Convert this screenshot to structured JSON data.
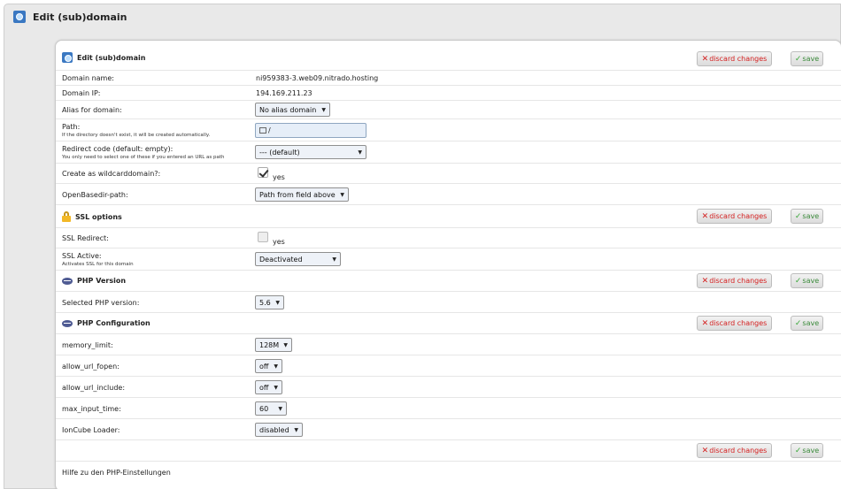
{
  "page": {
    "title": "Edit (sub)domain"
  },
  "sections": {
    "main": {
      "title": "Edit (sub)domain"
    },
    "ssl": {
      "title": "SSL options"
    },
    "php_version": {
      "title": "PHP Version"
    },
    "php_config": {
      "title": "PHP Configuration"
    }
  },
  "buttons": {
    "discard": "discard changes",
    "save": "save"
  },
  "fields": {
    "domain_name": {
      "label": "Domain name:",
      "value": "ni959383-3.web09.nitrado.hosting"
    },
    "domain_ip": {
      "label": "Domain IP:",
      "value": "194.169.211.23"
    },
    "alias": {
      "label": "Alias for domain:",
      "value": "No alias domain"
    },
    "path": {
      "label": "Path:",
      "hint": "If the directory doesn't exist, it will be created automatically.",
      "value": "/"
    },
    "redirect": {
      "label": "Redirect code (default: empty):",
      "hint": "You only need to select one of these if you entered an URL as path",
      "value": "--- (default)"
    },
    "wildcard": {
      "label": "Create as wildcarddomain?:",
      "checked": true,
      "option": "yes"
    },
    "openbasedir": {
      "label": "OpenBasedir-path:",
      "value": "Path from field above"
    },
    "ssl_redirect": {
      "label": "SSL Redirect:",
      "checked": false,
      "option": "yes"
    },
    "ssl_active": {
      "label": "SSL Active:",
      "hint": "Activates SSL for this domain",
      "value": "Deactivated"
    },
    "php_version": {
      "label": "Selected PHP version:",
      "value": "5.6"
    },
    "memory_limit": {
      "label": "memory_limit:",
      "value": "128M"
    },
    "allow_url_fopen": {
      "label": "allow_url_fopen:",
      "value": "off"
    },
    "allow_url_include": {
      "label": "allow_url_include:",
      "value": "off"
    },
    "max_input_time": {
      "label": "max_input_time:",
      "value": "60"
    },
    "ioncube": {
      "label": "IonCube Loader:",
      "value": "disabled"
    }
  },
  "footer": {
    "help_link": "Hilfe zu den PHP-Einstellungen"
  }
}
